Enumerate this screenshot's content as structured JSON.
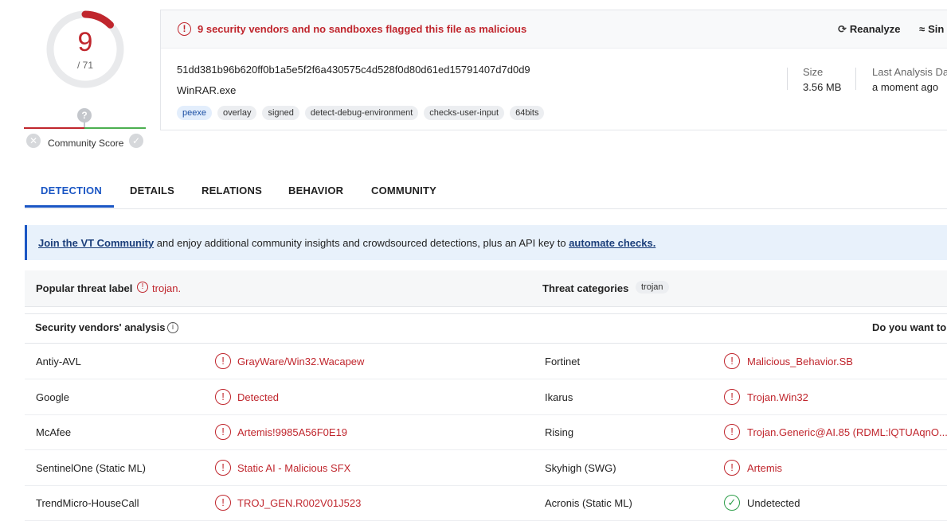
{
  "score": {
    "detections": "9",
    "total": "/ 71"
  },
  "community": {
    "label": "Community Score",
    "question_glyph": "?",
    "reject_glyph": "✕",
    "accept_glyph": "✓"
  },
  "summary": {
    "alert": "9 security vendors and no sandboxes flagged this file as malicious",
    "alert_glyph": "!",
    "reanalyze_label": "Reanalyze",
    "similar_label": "Sin",
    "hash": "51dd381b96b620ff0b1a5e5f2f6a430575c4d528f0d80d61ed15791407d7d0d9",
    "filename": "WinRAR.exe",
    "tags": [
      "peexe",
      "overlay",
      "signed",
      "detect-debug-environment",
      "checks-user-input",
      "64bits"
    ],
    "size_label": "Size",
    "size_value": "3.56 MB",
    "last_analysis_label": "Last Analysis Da",
    "last_analysis_value": "a moment ago"
  },
  "tabs": [
    "DETECTION",
    "DETAILS",
    "RELATIONS",
    "BEHAVIOR",
    "COMMUNITY"
  ],
  "banner": {
    "link1": "Join the VT Community",
    "text": " and enjoy additional community insights and crowdsourced detections, plus an API key to ",
    "link2": "automate checks."
  },
  "threat": {
    "popular_label": "Popular threat label",
    "popular_value": "trojan.",
    "categories_label": "Threat categories",
    "category_tag": "trojan"
  },
  "vendors": {
    "title": "Security vendors' analysis",
    "info_glyph": "i",
    "right_text": "Do you want to",
    "rows": [
      {
        "left_name": "Antiy-AVL",
        "left_result": "GrayWare/Win32.Wacapew",
        "right_name": "Fortinet",
        "right_result": "Malicious_Behavior.SB"
      },
      {
        "left_name": "Google",
        "left_result": "Detected",
        "right_name": "Ikarus",
        "right_result": "Trojan.Win32"
      },
      {
        "left_name": "McAfee",
        "left_result": "Artemis!9985A56F0E19",
        "right_name": "Rising",
        "right_result": "Trojan.Generic@AI.85 (RDML:lQTUAqnO..."
      },
      {
        "left_name": "SentinelOne (Static ML)",
        "left_result": "Static AI - Malicious SFX",
        "right_name": "Skyhigh (SWG)",
        "right_result": "Artemis"
      },
      {
        "left_name": "TrendMicro-HouseCall",
        "left_result": "TROJ_GEN.R002V01J523",
        "right_name": "Acronis (Static ML)",
        "right_result": "Undetected"
      }
    ],
    "malicious_glyph": "!",
    "clean_glyph": "✓"
  },
  "colors": {
    "malicious": "#c0262d",
    "clean": "#2e9e4a",
    "accent": "#1a56c4"
  }
}
